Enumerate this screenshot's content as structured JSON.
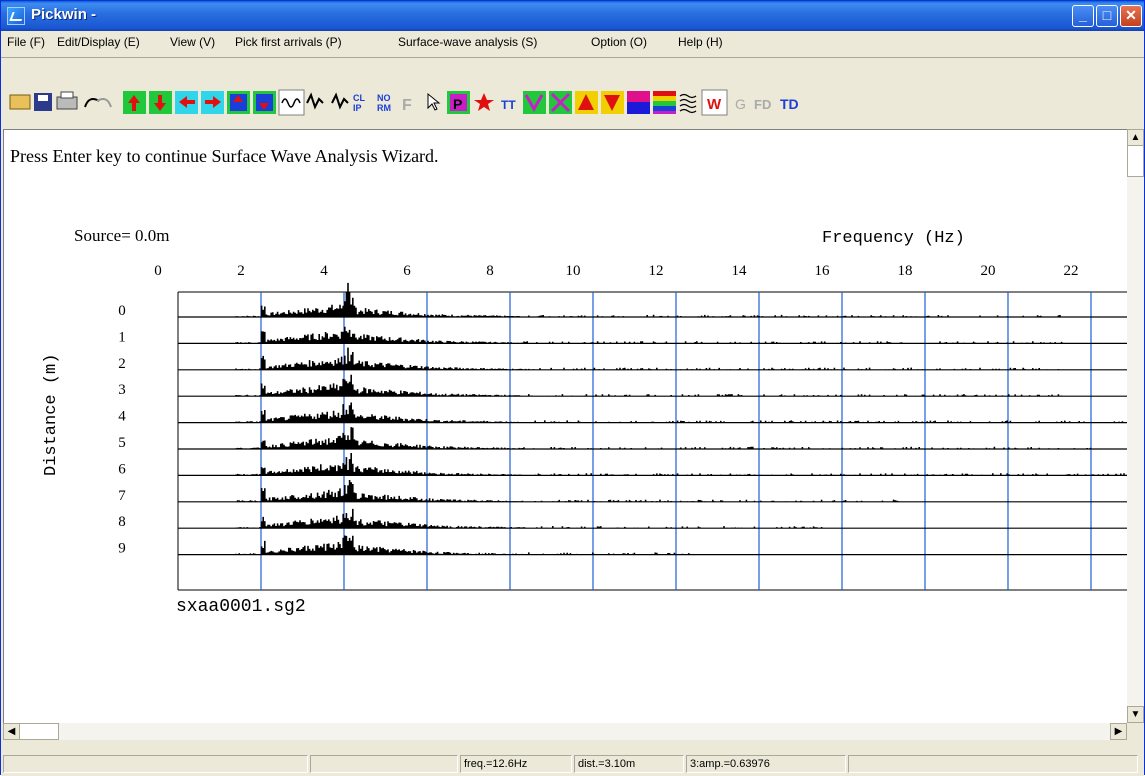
{
  "window": {
    "title": "Pickwin -"
  },
  "menus": [
    "File (F)",
    "Edit/Display (E)",
    "View (V)",
    "Pick first arrivals (P)",
    "Surface-wave analysis (S)",
    "Option (O)",
    "Help (H)"
  ],
  "toolbar": {
    "icons": [
      "open-icon",
      "save-icon",
      "print-icon",
      "undo-icon",
      "redo-icon",
      "arrow-up-icon",
      "arrow-down-icon",
      "arrow-left-icon",
      "arrow-right-icon",
      "expand-vertical-icon",
      "shrink-vertical-icon",
      "wiggle-trace-icon",
      "variable-area-icon",
      "wiggle-fill-icon",
      "clip-icon",
      "normalize-icon",
      "filter-icon",
      "pointer-icon",
      "pick-icon",
      "star-icon",
      "text-icon",
      "triangle-down-icon",
      "cross-icon",
      "red-triangle-icon",
      "red-down-triangle-icon",
      "color-bar-icon",
      "rainbow-icon",
      "waves-icon",
      "w-icon",
      "g-icon",
      "fd-icon",
      "td-icon"
    ],
    "labels": {
      "clip": "CL\nIP",
      "norm": "NO\nRM",
      "w": "W",
      "g": "G",
      "fd": "FD",
      "td": "TD",
      "p": "P",
      "t": "TT",
      "f": "F"
    }
  },
  "message": "Press Enter key to continue Surface Wave Analysis Wizard.",
  "plot": {
    "source_label": "Source= 0.0m",
    "x_axis_label": "Frequency (Hz)",
    "y_axis_label": "Distance (m)",
    "file_name": "sxaa0001.sg2",
    "x_ticks": [
      "0",
      "2",
      "4",
      "6",
      "8",
      "10",
      "12",
      "14",
      "16",
      "18",
      "20",
      "22"
    ],
    "y_ticks": [
      "0",
      "1",
      "2",
      "3",
      "4",
      "5",
      "6",
      "7",
      "8",
      "9"
    ],
    "grid_color": "#1f5fd8"
  },
  "status": {
    "freq": "freq.=12.6Hz",
    "dist": "dist.=3.10m",
    "amp": "3:amp.=0.63976"
  }
}
